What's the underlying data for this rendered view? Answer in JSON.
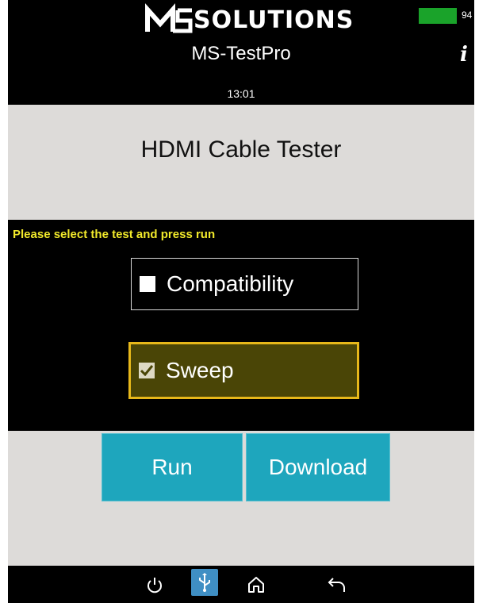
{
  "header": {
    "logo_text": "SOLUTIONS",
    "app_name": "MS-TestPro",
    "time": "13:01",
    "battery_text": "94",
    "battery_color": "#1aa32a",
    "info_icon": "info-icon"
  },
  "main": {
    "title": "HDMI Cable Tester",
    "prompt": "Please select the test and press run",
    "options": [
      {
        "label": "Compatibility",
        "checked": false
      },
      {
        "label": "Sweep",
        "checked": true
      }
    ]
  },
  "actions": {
    "run_label": "Run",
    "download_label": "Download",
    "button_color": "#1ea6bd"
  },
  "navbar": {
    "icons": [
      "power-icon",
      "usb-icon",
      "home-icon",
      "back-icon"
    ]
  },
  "colors": {
    "prompt": "#f2ea2b",
    "selected_border": "#e7b81a",
    "selected_fill": "#4a4506",
    "panel_gray": "#dddbd9"
  }
}
